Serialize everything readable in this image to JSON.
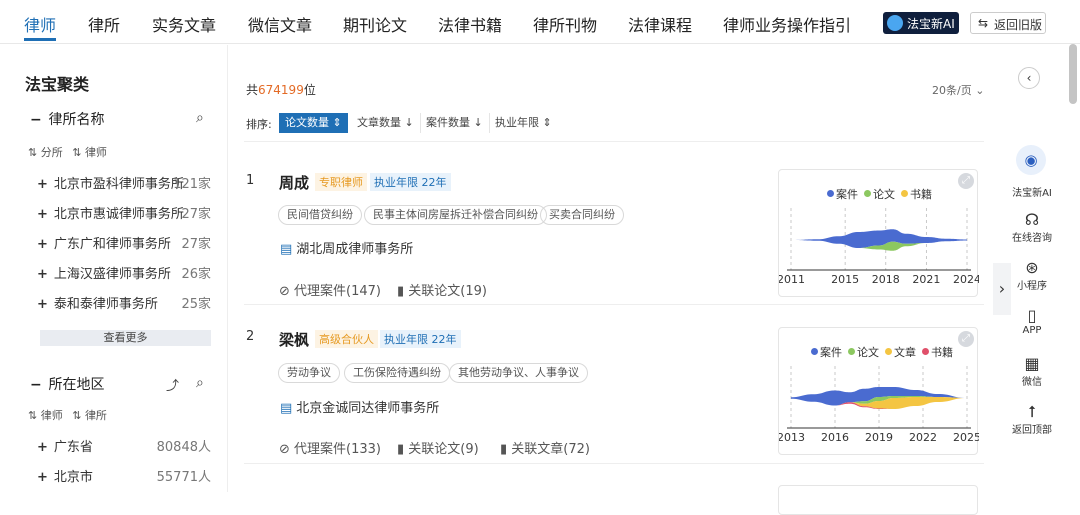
{
  "nav": {
    "tabs": [
      "律师",
      "律所",
      "实务文章",
      "微信文章",
      "期刊论文",
      "法律书籍",
      "律所刊物",
      "法律课程",
      "律师业务操作指引"
    ],
    "ai_label": "法宝新AI",
    "old_version": "返回旧版"
  },
  "sidebar": {
    "title": "法宝聚类",
    "firm_group": {
      "title": "律所名称",
      "sort": [
        "分所",
        "律师"
      ],
      "items": [
        {
          "label": "北京市盈科律师事务所",
          "count": "121家"
        },
        {
          "label": "北京市惠诚律师事务所",
          "count": "27家"
        },
        {
          "label": "广东广和律师事务所",
          "count": "27家"
        },
        {
          "label": "上海汉盛律师事务所",
          "count": "26家"
        },
        {
          "label": "泰和泰律师事务所",
          "count": "25家"
        }
      ],
      "more": "查看更多"
    },
    "region_group": {
      "title": "所在地区",
      "sort": [
        "律师",
        "律所"
      ],
      "items": [
        {
          "label": "广东省",
          "count": "80848人"
        },
        {
          "label": "北京市",
          "count": "55771人"
        }
      ]
    }
  },
  "main": {
    "total_prefix": "共",
    "total_num": "674199",
    "total_suffix": "位",
    "page_size": "20条/页",
    "sort_label": "排序:",
    "sort_options": [
      "论文数量",
      "文章数量",
      "案件数量",
      "执业年限"
    ],
    "results": [
      {
        "rank": "1",
        "name": "周成",
        "role": "专职律师",
        "years": "执业年限 22年",
        "tags": [
          "民间借贷纠纷",
          "民事主体间房屋拆迁补偿合同纠纷",
          "买卖合同纠纷"
        ],
        "firm": "湖北周成律师事务所",
        "links": [
          "代理案件(147)",
          "关联论文(19)"
        ]
      },
      {
        "rank": "2",
        "name": "梁枫",
        "role": "高级合伙人",
        "years": "执业年限 22年",
        "tags": [
          "劳动争议",
          "工伤保险待遇纠纷",
          "其他劳动争议、人事争议"
        ],
        "firm": "北京金诚同达律师事务所",
        "links": [
          "代理案件(133)",
          "关联论文(9)",
          "关联文章(72)"
        ]
      }
    ]
  },
  "colors": {
    "accent": "#1f6fb5",
    "case": "#4a6bd0",
    "paper": "#8cc860",
    "article": "#f4c542",
    "book": "#f4c542"
  },
  "chart_data": [
    {
      "type": "area",
      "series": [
        {
          "name": "案件",
          "color": "#4a6bd0",
          "values": [
            0,
            0.3,
            1.5,
            3.2,
            3.0,
            2.5,
            2.0,
            1.2,
            0.5,
            0.2
          ]
        },
        {
          "name": "论文",
          "color": "#8cc860",
          "values": [
            0,
            0,
            0,
            0,
            0.8,
            1.8,
            0.5,
            0,
            0,
            0
          ]
        },
        {
          "name": "书籍",
          "color": "#f4c542",
          "values": [
            0,
            0,
            0,
            0,
            0,
            0,
            0,
            0,
            0,
            0
          ]
        }
      ],
      "x": [
        2011,
        2013,
        2014.5,
        2016,
        2017.5,
        2018.5,
        2019.5,
        2021,
        2022.5,
        2024
      ],
      "x_ticks": [
        "2011",
        "2015",
        "2018",
        "2021",
        "2024"
      ],
      "legend": "top"
    },
    {
      "type": "area",
      "series": [
        {
          "name": "案件",
          "color": "#4a6bd0",
          "values": [
            0.3,
            1.5,
            3.0,
            2.0,
            2.5,
            2.0,
            1.8,
            1.2,
            0.6,
            0
          ]
        },
        {
          "name": "论文",
          "color": "#8cc860",
          "values": [
            0,
            0,
            0,
            0,
            0.5,
            0.8,
            0.4,
            0.2,
            0,
            0
          ]
        },
        {
          "name": "文章",
          "color": "#f4c542",
          "values": [
            0,
            0,
            0,
            0,
            0.5,
            1.5,
            2.2,
            1.8,
            1.0,
            0
          ]
        },
        {
          "name": "书籍",
          "color": "#e0506a",
          "values": [
            0,
            0,
            0,
            0.3,
            0.2,
            0.1,
            0,
            0,
            0,
            0
          ]
        }
      ],
      "x": [
        2013,
        2014.5,
        2016,
        2017,
        2018,
        2019,
        2020,
        2021.5,
        2023,
        2025
      ],
      "x_ticks": [
        "2013",
        "2016",
        "2019",
        "2022",
        "2025"
      ],
      "legend": "top"
    }
  ]
}
